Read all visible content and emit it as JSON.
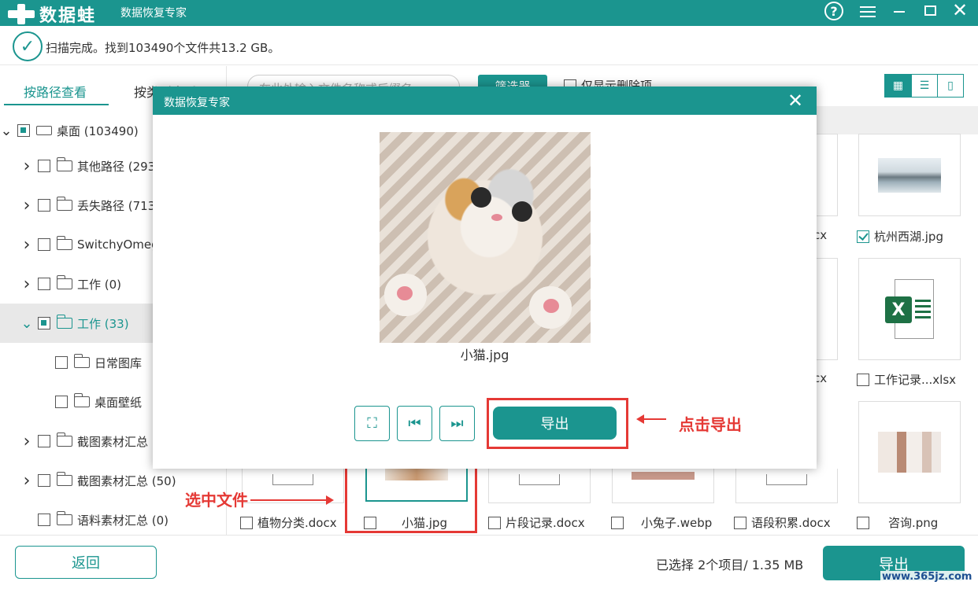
{
  "app": {
    "brand": "数据蛙",
    "subtitle": "数据恢复专家",
    "help_icon": "?",
    "close_icon": "✕"
  },
  "status": {
    "message": "扫描完成。找到103490个文件共13.2 GB。"
  },
  "sidebar": {
    "tabs": [
      "按路径查看",
      "按类型查看"
    ],
    "tree": [
      {
        "label": "桌面 (103490)",
        "level": 0,
        "expanded": true,
        "check": "partial",
        "icon": "drive-icon"
      },
      {
        "label": "其他路径 (293",
        "level": 1,
        "expanded": false,
        "check": "none",
        "icon": "folder-icon"
      },
      {
        "label": "丢失路径 (713",
        "level": 1,
        "expanded": false,
        "check": "none",
        "icon": "folder-icon"
      },
      {
        "label": "SwitchyOmeg",
        "level": 1,
        "expanded": false,
        "check": "none",
        "icon": "folder-icon"
      },
      {
        "label": "工作 (0)",
        "level": 1,
        "expanded": false,
        "check": "none",
        "icon": "folder-icon"
      },
      {
        "label": "工作 (33)",
        "level": 1,
        "expanded": true,
        "check": "partial",
        "icon": "folder-icon",
        "selected": true
      },
      {
        "label": "日常图库",
        "level": 2,
        "check": "none",
        "icon": "folder-icon"
      },
      {
        "label": "桌面壁纸",
        "level": 2,
        "check": "none",
        "icon": "folder-icon"
      },
      {
        "label": "截图素材汇总",
        "level": 1,
        "expanded": false,
        "check": "none",
        "icon": "folder-icon"
      },
      {
        "label": "截图素材汇总 (50)",
        "level": 1,
        "expanded": false,
        "check": "none",
        "icon": "folder-icon"
      },
      {
        "label": "语料素材汇总 (0)",
        "level": 1,
        "check": "none",
        "icon": "folder-icon"
      }
    ]
  },
  "toolbar": {
    "search_placeholder": "在此处输入文件名称或后缀名",
    "filter_label": "筛选器",
    "only_deleted_label": "仅显示删除项"
  },
  "files": {
    "right_column": [
      {
        "name": "杭州西湖.jpg",
        "checked": true
      },
      {
        "name": "工作记录...xlsx",
        "checked": false
      },
      {
        "name": "咨询.png",
        "checked": false
      }
    ],
    "partial_labels": [
      "cx",
      "cx"
    ],
    "bottom_row": [
      {
        "name": "植物分类.docx",
        "checked": false
      },
      {
        "name": "小猫.jpg",
        "checked": false
      },
      {
        "name": "片段记录.docx",
        "checked": false
      },
      {
        "name": "小兔子.webp",
        "checked": false
      },
      {
        "name": "语段积累.docx",
        "checked": false
      }
    ]
  },
  "dialog": {
    "title": "数据恢复专家",
    "file_name": "小猫.jpg",
    "export_label": "导出"
  },
  "annotations": {
    "click_export": "点击导出",
    "select_file": "选中文件"
  },
  "footer": {
    "back_label": "返回",
    "selection_info": "已选择 2个项目/ 1.35 MB",
    "export_label": "导出"
  },
  "watermark": "www.365jz.com",
  "colors": {
    "accent": "#1b958f",
    "annotation": "#e53935"
  }
}
